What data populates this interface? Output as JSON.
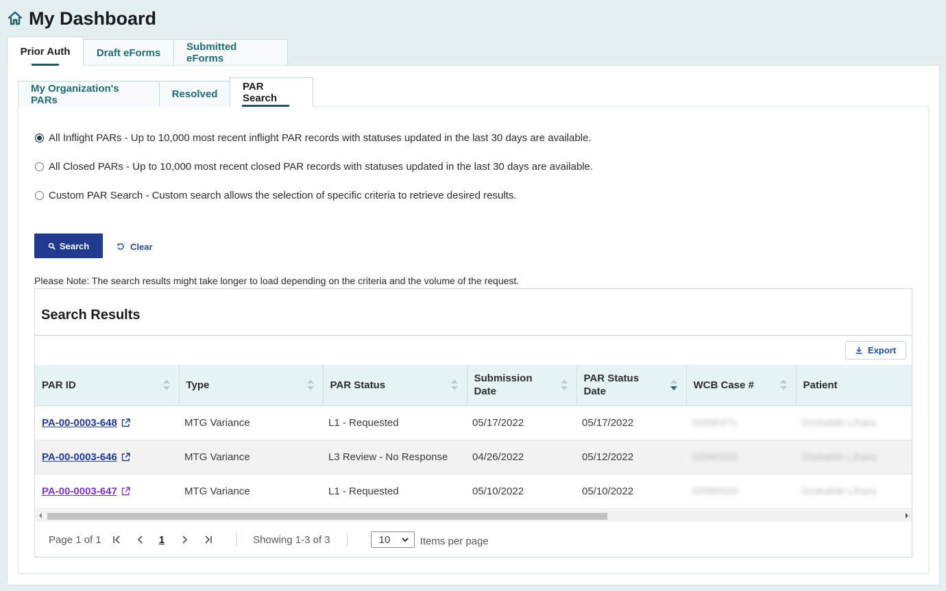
{
  "page": {
    "title": "My Dashboard"
  },
  "top_tabs": [
    {
      "label": "Prior Auth",
      "active": true
    },
    {
      "label": "Draft eForms",
      "active": false
    },
    {
      "label": "Submitted eForms",
      "active": false
    }
  ],
  "sub_tabs": [
    {
      "label": "My Organization's PARs",
      "active": false
    },
    {
      "label": "Resolved",
      "active": false
    },
    {
      "label": "PAR Search",
      "active": true
    }
  ],
  "search_options": [
    {
      "label": "All Inflight PARs - Up to 10,000 most recent inflight PAR records with statuses updated in the last 30 days are available.",
      "checked": true
    },
    {
      "label": "All Closed PARs - Up to 10,000 most recent closed PAR records with statuses updated in the last 30 days are available.",
      "checked": false
    },
    {
      "label": "Custom PAR Search - Custom search allows the selection of specific criteria to retrieve desired results.",
      "checked": false
    }
  ],
  "buttons": {
    "search": "Search",
    "clear": "Clear",
    "export": "Export"
  },
  "note": "Please Note:  The search results might take longer to load depending on the criteria and the volume of the request.",
  "results": {
    "title": "Search Results",
    "columns": [
      "PAR ID",
      "Type",
      "PAR Status",
      "Submission Date",
      "PAR Status Date",
      "WCB Case #",
      "Patient"
    ],
    "column_lines": [
      [
        "PAR ID"
      ],
      [
        "Type"
      ],
      [
        "PAR Status"
      ],
      [
        "Submission",
        "Date"
      ],
      [
        "PAR Status",
        "Date"
      ],
      [
        "WCB Case #"
      ],
      [
        "Patient"
      ]
    ],
    "sorted_column": "PAR Status Date",
    "rows": [
      {
        "par_id": "PA-00-0003-648",
        "type": "MTG Variance",
        "status": "L1 - Requested",
        "submission_date": "05/17/2022",
        "status_date": "05/17/2022",
        "wcb_case": "02990371",
        "patient": "Grobalski Lihara",
        "visited": false
      },
      {
        "par_id": "PA-00-0003-646",
        "type": "MTG Variance",
        "status": "L3 Review - No Response",
        "submission_date": "04/26/2022",
        "status_date": "05/12/2022",
        "wcb_case": "02990033",
        "patient": "Grobalski Lihara",
        "visited": false
      },
      {
        "par_id": "PA-00-0003-647",
        "type": "MTG Variance",
        "status": "L1 - Requested",
        "submission_date": "05/10/2022",
        "status_date": "05/10/2022",
        "wcb_case": "02990033",
        "patient": "Grobalski Lihara",
        "visited": true
      }
    ]
  },
  "pagination": {
    "page_label": "Page 1 of 1",
    "current_page": "1",
    "showing": "Showing 1-3 of 3",
    "per_page": "10",
    "per_page_label": "Items per page"
  },
  "colors": {
    "primary_button": "#1f3a8e",
    "link": "#1f3a8e",
    "visited_link": "#7a35b8",
    "tab_text": "#1f6b78",
    "header_bg": "#e6f3f5"
  }
}
